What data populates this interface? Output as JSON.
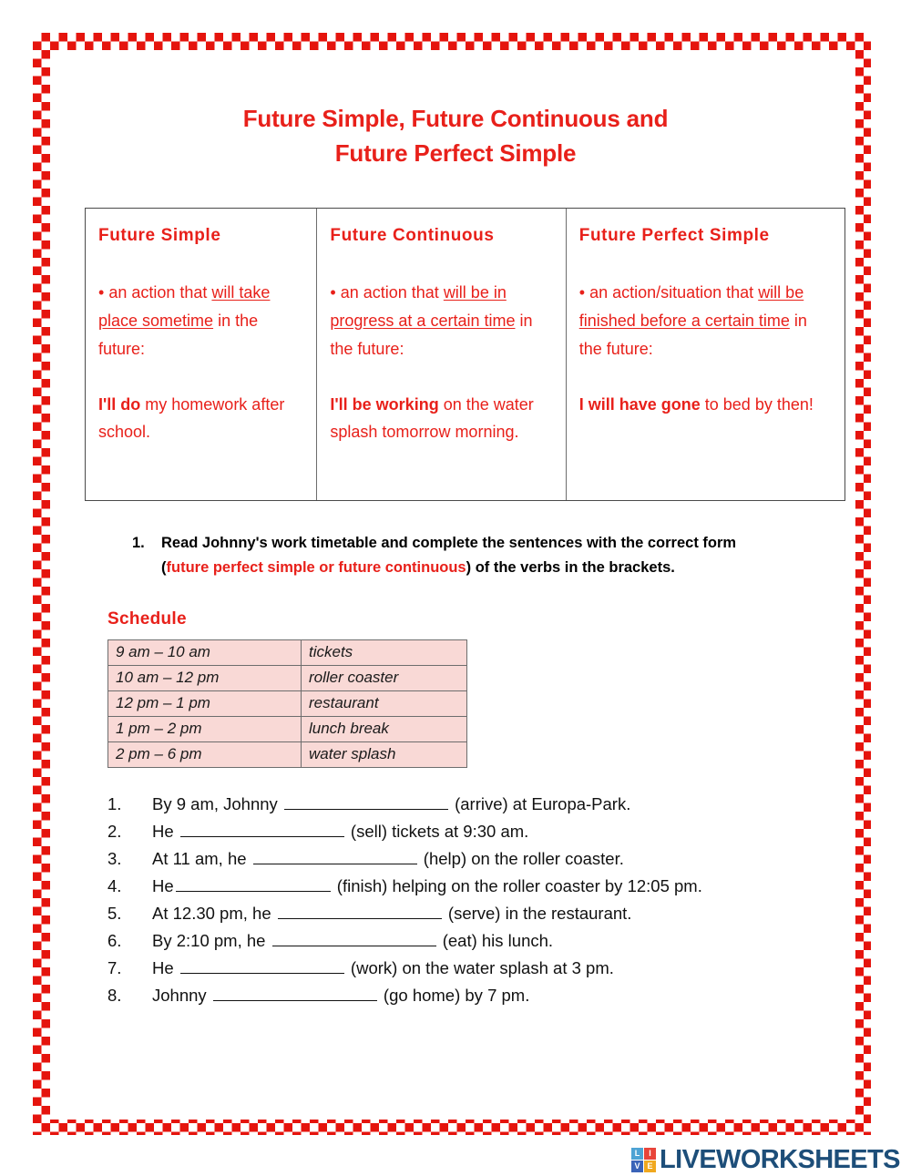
{
  "page": {
    "title_line1": "Future Simple, Future Continuous and",
    "title_line2": "Future Perfect Simple",
    "accent_red": "#e8201a",
    "border_red": "#e5140d",
    "schedule_bg": "#f9d9d6"
  },
  "grammar_table": {
    "columns": [
      {
        "heading": "Future Simple",
        "bullet": "•",
        "definition_plain_1": "an action that ",
        "definition_underlined": "will take place sometime",
        "definition_plain_2": " in the future:",
        "example_bold": "I'll do",
        "example_rest": " my homework after school."
      },
      {
        "heading": "Future Continuous",
        "bullet": "•",
        "definition_plain_1": "an action that ",
        "definition_underlined": "will be in progress at a certain time",
        "definition_plain_2": " in the future:",
        "example_bold": "I'll be working",
        "example_rest": " on the water splash tomorrow morning."
      },
      {
        "heading": "Future Perfect Simple",
        "bullet": "•",
        "definition_plain_1": "an action/situation that ",
        "definition_underlined": "will be finished before a certain time",
        "definition_plain_2": " in the future:",
        "example_bold": "I will have gone",
        "example_rest": " to bed by then!"
      }
    ]
  },
  "exercise": {
    "number": "1.",
    "text_part1": "Read Johnny's work timetable and complete the sentences with the correct form (",
    "highlight": "future perfect simple or future continuous",
    "text_part2": ") of the verbs in the brackets."
  },
  "schedule": {
    "label": "Schedule",
    "rows": [
      {
        "time": "9 am – 10 am",
        "activity": "tickets"
      },
      {
        "time": "10 am – 12 pm",
        "activity": "roller coaster"
      },
      {
        "time": "12 pm – 1 pm",
        "activity": "restaurant"
      },
      {
        "time": "1 pm – 2 pm",
        "activity": "lunch break"
      },
      {
        "time": "2 pm – 6 pm",
        "activity": "water splash"
      }
    ]
  },
  "sentences": [
    {
      "num": "1.",
      "before": "By 9 am, Johnny ",
      "after": " (arrive) at Europa-Park."
    },
    {
      "num": "2.",
      "before": "He ",
      "after": " (sell) tickets at 9:30 am."
    },
    {
      "num": "3.",
      "before": "At 11 am, he ",
      "after": " (help) on the roller coaster."
    },
    {
      "num": "4.",
      "before": "He",
      "after": " (finish) helping on the roller coaster by 12:05 pm."
    },
    {
      "num": "5.",
      "before": "At 12.30 pm, he ",
      "after": " (serve) in the restaurant."
    },
    {
      "num": "6.",
      "before": "By 2:10 pm, he ",
      "after": " (eat) his lunch."
    },
    {
      "num": "7.",
      "before": "He ",
      "after": " (work) on the water splash at 3 pm."
    },
    {
      "num": "8.",
      "before": "Johnny ",
      "after": " (go home) by 7 pm."
    }
  ],
  "footer": {
    "badge_letters": [
      "L",
      "I",
      "V",
      "E"
    ],
    "wordmark": "LIVEWORKSHEETS"
  }
}
